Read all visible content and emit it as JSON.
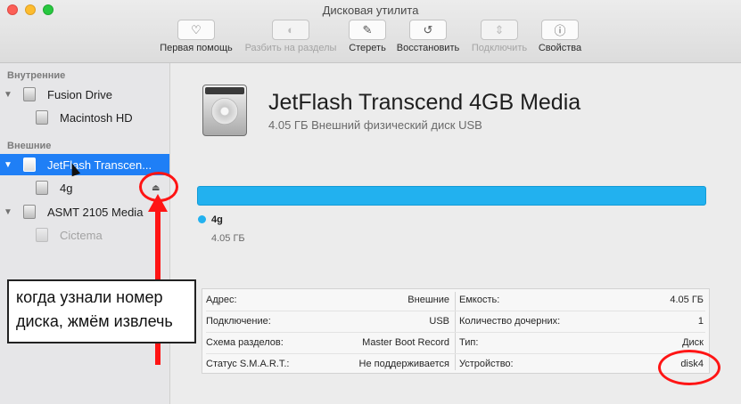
{
  "window": {
    "title": "Дисковая утилита"
  },
  "toolbar": {
    "buttons": [
      {
        "label": "Первая помощь",
        "icon": "stethoscope-icon",
        "glyph": "♡",
        "enabled": true
      },
      {
        "label": "Разбить на разделы",
        "icon": "partition-icon",
        "glyph": "◐",
        "enabled": false
      },
      {
        "label": "Стереть",
        "icon": "erase-icon",
        "glyph": "✎",
        "enabled": true
      },
      {
        "label": "Восстановить",
        "icon": "restore-icon",
        "glyph": "↺",
        "enabled": true
      },
      {
        "label": "Подключить",
        "icon": "mount-icon",
        "glyph": "⇕",
        "enabled": false
      },
      {
        "label": "Свойства",
        "icon": "info-icon",
        "glyph": "ⓘ",
        "enabled": true
      }
    ]
  },
  "sidebar": {
    "internal_header": "Внутренние",
    "external_header": "Внешние",
    "items": [
      {
        "label": "Fusion Drive"
      },
      {
        "label": "Macintosh HD"
      },
      {
        "label": "JetFlash Transcen..."
      },
      {
        "label": "4g"
      },
      {
        "label": "ASMT 2105 Media"
      },
      {
        "label": "Cictema"
      }
    ],
    "eject_glyph": "⏏"
  },
  "disk": {
    "name": "JetFlash Transcend 4GB Media",
    "subtitle": "4.05 ГБ Внешний физический диск USB",
    "partition_name": "4g",
    "partition_size": "4.05 ГБ",
    "accent": "#22b1ef",
    "usage_fraction": 1.0
  },
  "info": {
    "left": [
      {
        "key": "Адрес:",
        "value": "Внешние"
      },
      {
        "key": "Подключение:",
        "value": "USB"
      },
      {
        "key": "Схема разделов:",
        "value": "Master Boot Record"
      },
      {
        "key": "Статус S.M.A.R.T.:",
        "value": "Не поддерживается"
      }
    ],
    "right": [
      {
        "key": "Емкость:",
        "value": "4.05 ГБ"
      },
      {
        "key": "Количество дочерних:",
        "value": "1"
      },
      {
        "key": "Тип:",
        "value": "Диск"
      },
      {
        "key": "Устройство:",
        "value": "disk4"
      }
    ]
  },
  "annotation": {
    "text_line1": "когда узнали номер",
    "text_line2": "диска, жмём извлечь",
    "color": "#ff1414"
  }
}
